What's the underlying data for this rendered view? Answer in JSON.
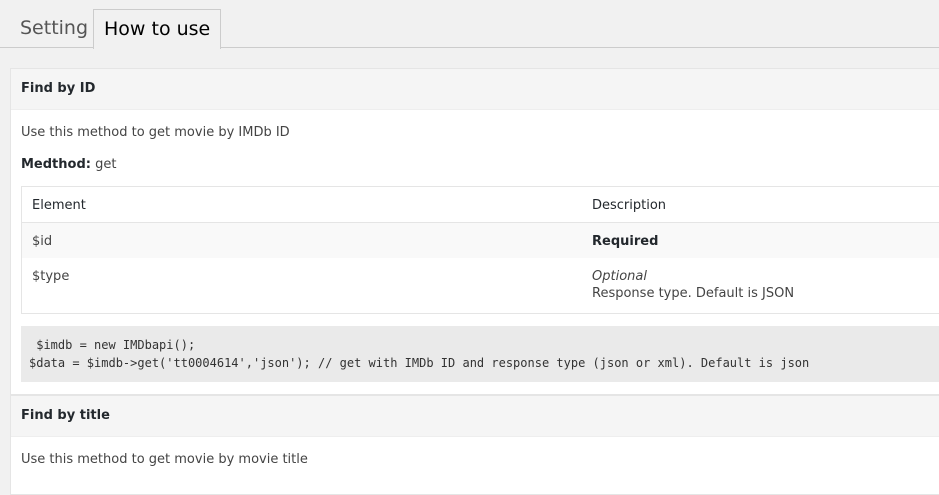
{
  "tabs": {
    "setting": "Setting",
    "how_to_use": "How to use"
  },
  "section1": {
    "title": "Find by ID",
    "description": "Use this method to get movie by IMDb ID",
    "method_label": "Medthod:",
    "method_value": " get",
    "table": {
      "header_element": "Element",
      "header_description": "Description",
      "rows": [
        {
          "element": "$id",
          "description": "Required"
        },
        {
          "element": "$type",
          "description": "Optional",
          "subdescription": "Response type. Default is JSON"
        }
      ]
    },
    "code_lines": [
      " $imdb = new IMDbapi();",
      "$data = $imdb->get('tt0004614','json'); // get with IMDb ID and response type (json or xml). Default is json"
    ]
  },
  "section2": {
    "title": "Find by title",
    "description": "Use this method to get movie by movie title"
  }
}
